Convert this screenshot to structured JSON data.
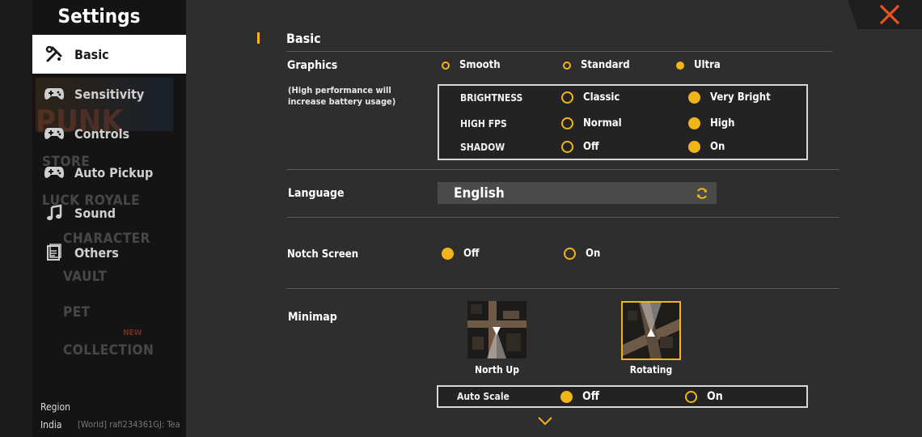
{
  "sidebar": {
    "title": "Settings",
    "items": [
      {
        "label": "Basic",
        "icon": "wrench-screwdriver-icon"
      },
      {
        "label": "Sensitivity",
        "icon": "gamepad-icon"
      },
      {
        "label": "Controls",
        "icon": "gamepad-icon"
      },
      {
        "label": "Auto Pickup",
        "icon": "gamepad-icon"
      },
      {
        "label": "Sound",
        "icon": "music-note-icon"
      },
      {
        "label": "Others",
        "icon": "document-icon"
      }
    ],
    "background_menu": [
      "STORE",
      "LUCK ROYALE",
      "CHARACTER",
      "VAULT",
      "PET",
      "COLLECTION"
    ],
    "background_poster": "PUNK",
    "new_badge": "NEW",
    "region_label": "Region",
    "region_value": "India",
    "chat_preview": "[World] rafi234361GJ: Tea"
  },
  "basic": {
    "section_title": "Basic",
    "graphics": {
      "label": "Graphics",
      "note": "(High performance will increase battery usage)",
      "options": [
        "Smooth",
        "Standard",
        "Ultra"
      ],
      "selected": "Ultra",
      "brightness": {
        "label": "BRIGHTNESS",
        "options": [
          "Classic",
          "Very Bright"
        ],
        "selected": "Very Bright"
      },
      "high_fps": {
        "label": "HIGH FPS",
        "options": [
          "Normal",
          "High"
        ],
        "selected": "High"
      },
      "shadow": {
        "label": "SHADOW",
        "options": [
          "Off",
          "On"
        ],
        "selected": "On"
      }
    },
    "language": {
      "label": "Language",
      "value": "English"
    },
    "notch_screen": {
      "label": "Notch Screen",
      "options": [
        "Off",
        "On"
      ],
      "selected": "Off"
    },
    "minimap": {
      "label": "Minimap",
      "options": [
        "North Up",
        "Rotating"
      ],
      "selected": "Rotating",
      "auto_scale": {
        "label": "Auto Scale",
        "options": [
          "Off",
          "On"
        ],
        "selected": "Off"
      }
    }
  },
  "colors": {
    "accent": "#f2b418",
    "close": "#e8531e",
    "panel": "#2e2e2e",
    "sidebar": "#141414"
  }
}
